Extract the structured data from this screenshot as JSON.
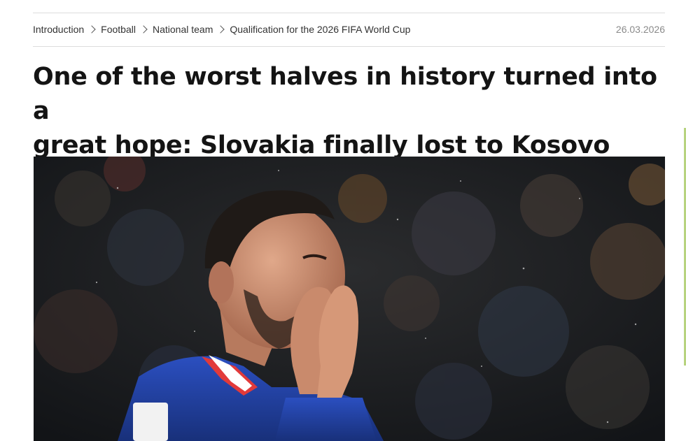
{
  "breadcrumb": {
    "items": [
      {
        "label": "Introduction"
      },
      {
        "label": "Football"
      },
      {
        "label": "National team"
      },
      {
        "label": "Qualification for the 2026 FIFA World Cup"
      }
    ]
  },
  "article": {
    "date": "26.03.2026",
    "headline_line1": "One of the worst halves in history turned into a",
    "headline_line2": "great hope: Slovakia finally lost to Kosovo"
  },
  "colors": {
    "headline": "#141414",
    "breadcrumb_text": "#333333",
    "date_text": "#8a8a8a",
    "divider": "#dcdcdc",
    "jersey_blue": "#1f3fa0",
    "stadium_background": "#1a1d22"
  }
}
